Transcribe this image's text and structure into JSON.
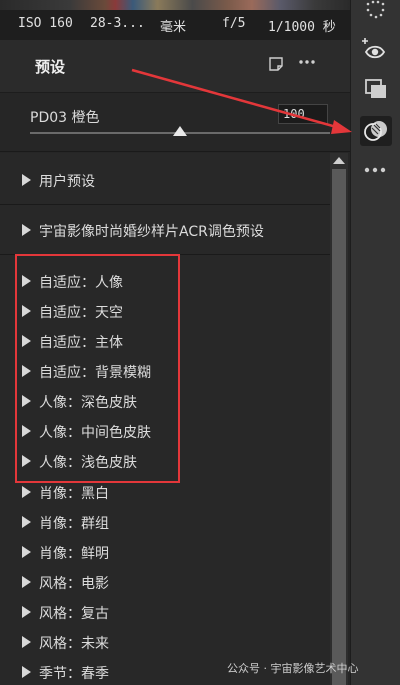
{
  "exif": {
    "iso": "ISO 160",
    "focal": "28-3...",
    "unit": "毫米",
    "aperture": "f/5",
    "shutter": "1/1000 秒"
  },
  "panel": {
    "title": "预设",
    "icons": [
      "new-preset-icon",
      "more-icon"
    ]
  },
  "preset_amount": {
    "name": "PD03 橙色",
    "value": "100"
  },
  "groups": [
    {
      "label": "用户预设"
    },
    {
      "label": "宇宙影像时尚婚纱样片ACR调色预设"
    }
  ],
  "items": [
    {
      "label": "自适应：人像"
    },
    {
      "label": "自适应：天空"
    },
    {
      "label": "自适应：主体"
    },
    {
      "label": "自适应：背景模糊"
    },
    {
      "label": "人像：深色皮肤"
    },
    {
      "label": "人像：中间色皮肤"
    },
    {
      "label": "人像：浅色皮肤"
    },
    {
      "label": "肖像：黑白"
    },
    {
      "label": "肖像：群组"
    },
    {
      "label": "肖像：鲜明"
    },
    {
      "label": "风格：电影"
    },
    {
      "label": "风格：复古"
    },
    {
      "label": "风格：未来"
    },
    {
      "label": "季节：春季"
    }
  ],
  "toolstrip": {
    "tools": [
      "grid-icon",
      "eye-plus-icon",
      "layers-icon",
      "presets-icon",
      "more-icon"
    ],
    "active_tool": "presets-icon"
  },
  "colors": {
    "annotation_red": "#e3373a",
    "panel_bg": "#282828"
  },
  "watermark": {
    "text": "公众号 · 宇宙影像艺术中心"
  }
}
